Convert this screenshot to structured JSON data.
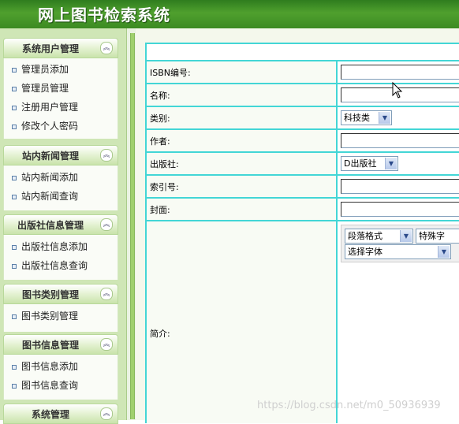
{
  "app": {
    "title": "网上图书检索系统"
  },
  "sidebar": {
    "sections": [
      {
        "title": "系统用户管理",
        "items": [
          "管理员添加",
          "管理员管理",
          "注册用户管理",
          "修改个人密码"
        ]
      },
      {
        "title": "站内新闻管理",
        "items": [
          "站内新闻添加",
          "站内新闻查询"
        ]
      },
      {
        "title": "出版社信息管理",
        "items": [
          "出版社信息添加",
          "出版社信息查询"
        ]
      },
      {
        "title": "图书类别管理",
        "items": [
          "图书类别管理"
        ]
      },
      {
        "title": "图书信息管理",
        "items": [
          "图书信息添加",
          "图书信息查询"
        ]
      },
      {
        "title": "系统管理",
        "items": []
      }
    ],
    "collapse_icon": "double-chevron-up-icon"
  },
  "form": {
    "fields": {
      "isbn": {
        "label": "ISBN编号:",
        "value": ""
      },
      "name": {
        "label": "名称:",
        "value": ""
      },
      "category": {
        "label": "类别:",
        "selected": "科技类"
      },
      "author": {
        "label": "作者:",
        "value": ""
      },
      "publisher": {
        "label": "出版社:",
        "selected": "D出版社"
      },
      "index_no": {
        "label": "索引号:",
        "value": ""
      },
      "cover": {
        "label": "封面:",
        "value": ""
      },
      "intro": {
        "label": "简介:"
      }
    },
    "editor": {
      "paragraph_format": "段落格式",
      "special_chars": "特殊字",
      "font_select": "选择字体"
    }
  },
  "watermark": "https://blog.csdn.net/m0_50936939"
}
